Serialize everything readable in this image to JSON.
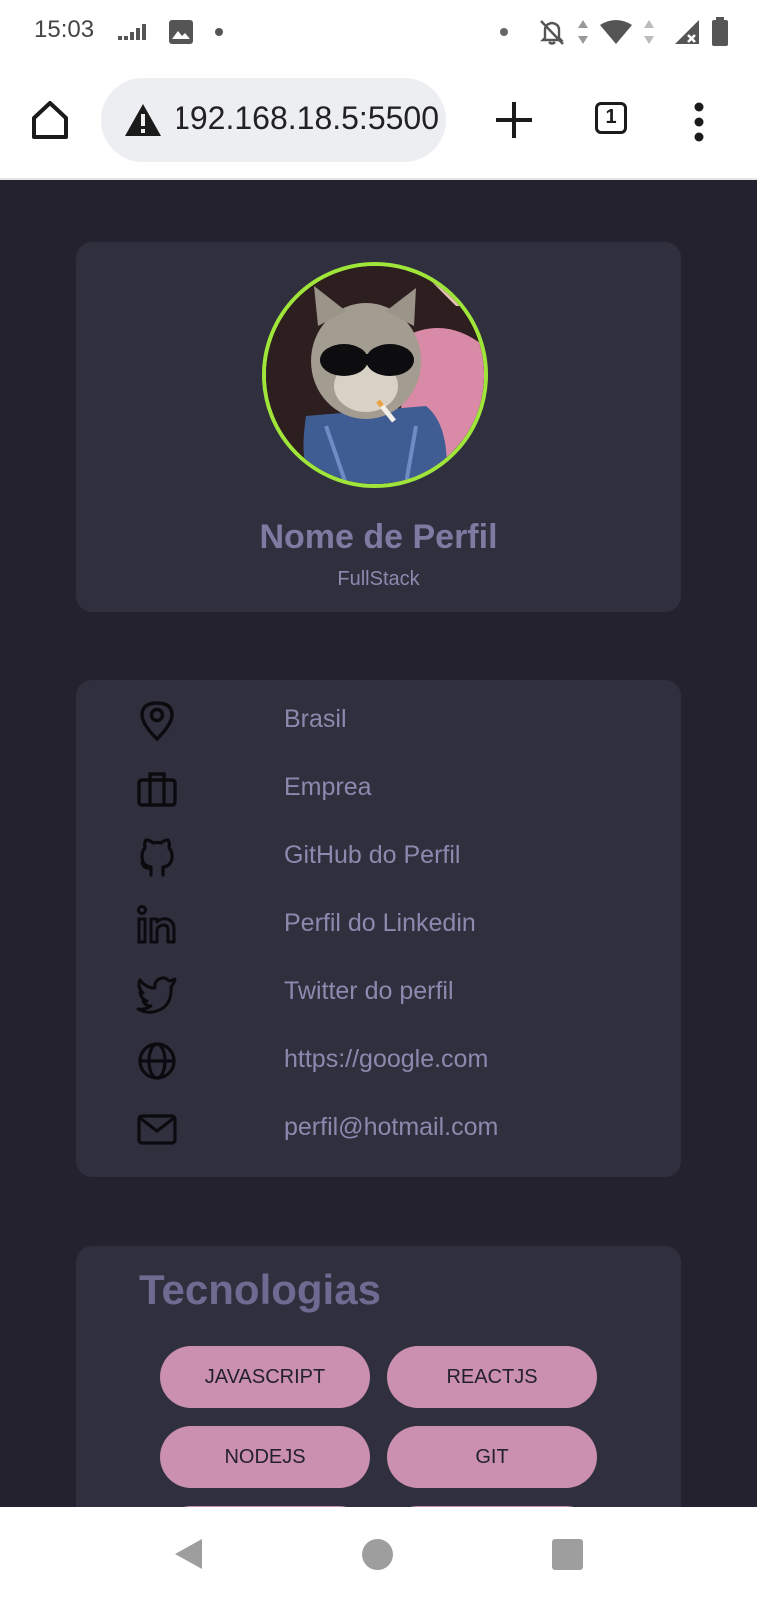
{
  "status_bar": {
    "time": "15:03",
    "icons_left": [
      "signal-bars-icon",
      "image-icon",
      "dot-icon"
    ],
    "icons_right": [
      "dot-icon",
      "notifications-off-icon",
      "data-arrows-icon",
      "wifi-icon",
      "cell-signal-icon",
      "battery-icon"
    ]
  },
  "browser": {
    "url": "192.168.18.5:5500",
    "tab_count": "1",
    "icons": [
      "home-icon",
      "warning-icon",
      "plus-icon",
      "menu-dots-icon"
    ]
  },
  "profile": {
    "name": "Nome de Perfil",
    "role": "FullStack",
    "avatar_border_color": "#9fe53a"
  },
  "info": {
    "items": [
      {
        "icon": "location-pin-icon",
        "text": "Brasil"
      },
      {
        "icon": "briefcase-icon",
        "text": "Emprea"
      },
      {
        "icon": "github-icon",
        "text": "GitHub do Perfil"
      },
      {
        "icon": "linkedin-icon",
        "text": "Perfil do Linkedin"
      },
      {
        "icon": "twitter-icon",
        "text": "Twitter do perfil"
      },
      {
        "icon": "globe-icon",
        "text": "https://google.com"
      },
      {
        "icon": "mail-icon",
        "text": "perfil@hotmail.com"
      }
    ]
  },
  "technologies": {
    "title": "Tecnologias",
    "items": [
      "JAVASCRIPT",
      "REACTJS",
      "NODEJS",
      "GIT"
    ]
  },
  "colors": {
    "page_background": "#23222e",
    "card_background": "#302f3e",
    "accent_text": "#8d89ae",
    "pill_background": "#cb8fb0"
  },
  "nav_bar": {
    "icons": [
      "back-icon",
      "home-circle-icon",
      "recents-icon"
    ]
  }
}
